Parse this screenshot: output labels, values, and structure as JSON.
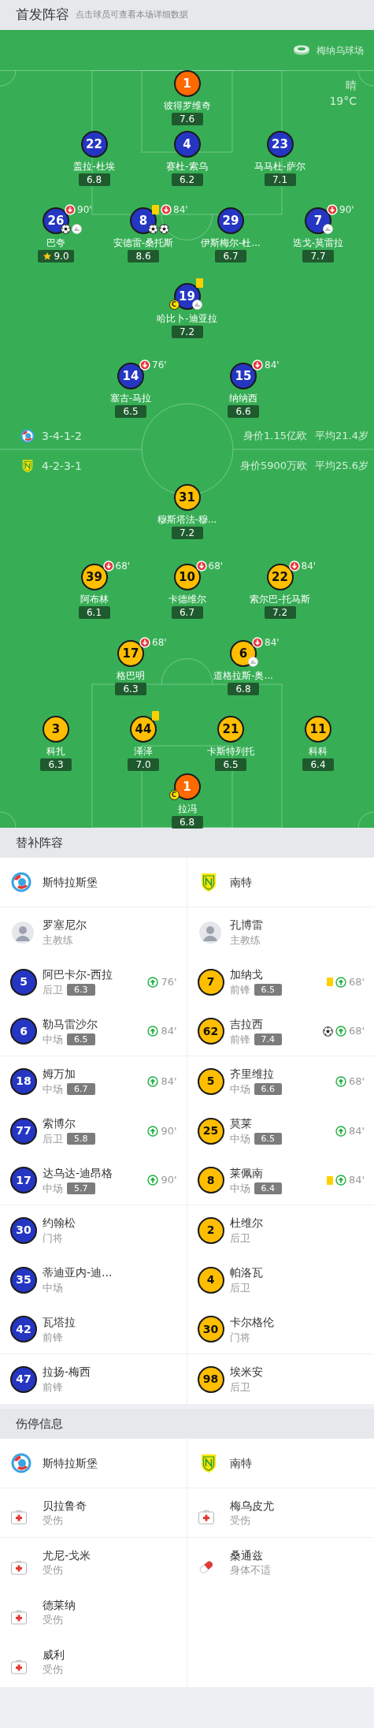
{
  "lineup_header": {
    "title": "首发阵容",
    "hint": "点击球员可查看本场详细数据"
  },
  "pitch": {
    "stadium": "梅纳乌球场",
    "weather": "晴",
    "temperature": "19°C",
    "home": {
      "color": "#2536c3",
      "rows": [
        {
          "kind": "goalkeeper",
          "players": [
            {
              "number": "1",
              "name": "彼得罗维奇",
              "rating": "7.6"
            }
          ]
        },
        {
          "kind": "outfield",
          "players": [
            {
              "number": "22",
              "name": "盖拉-杜埃",
              "rating": "6.8"
            },
            {
              "number": "4",
              "name": "赛杜-索乌",
              "rating": "6.2"
            },
            {
              "number": "23",
              "name": "马马杜-萨尔",
              "rating": "7.1"
            }
          ]
        },
        {
          "kind": "outfield",
          "players": [
            {
              "number": "26",
              "name": "巴夸",
              "rating": "9.0",
              "sub_off": "90'",
              "marks": [
                {
                  "kind": "best"
                }
              ],
              "events": [
                {
                  "kind": "goal"
                },
                {
                  "kind": "assist"
                }
              ]
            },
            {
              "number": "8",
              "name": "安德雷-桑托斯",
              "rating": "8.6",
              "sub_off": "84'",
              "marks": [
                {
                  "kind": "yellow_card"
                }
              ],
              "events": [
                {
                  "kind": "goal"
                },
                {
                  "kind": "goal"
                }
              ]
            },
            {
              "number": "29",
              "name": "伊斯梅尔-杜...",
              "rating": "6.7"
            },
            {
              "number": "7",
              "name": "迭戈-莫雷拉",
              "rating": "7.7",
              "sub_off": "90'",
              "events": [
                {
                  "kind": "assist"
                }
              ]
            }
          ]
        },
        {
          "kind": "outfield",
          "players": [
            {
              "number": "19",
              "name": "哈比卜-迪亚拉",
              "rating": "7.2",
              "marks": [
                {
                  "kind": "yellow_card"
                },
                {
                  "kind": "captain",
                  "label": "C"
                }
              ],
              "events": [
                {
                  "kind": "assist"
                }
              ]
            }
          ]
        },
        {
          "kind": "outfield",
          "players": [
            {
              "number": "14",
              "name": "塞古-马拉",
              "rating": "6.5",
              "sub_off": "76'"
            },
            {
              "number": "15",
              "name": "纳纳西",
              "rating": "6.6",
              "sub_off": "84'"
            }
          ]
        }
      ]
    },
    "summaries": [
      {
        "kind": "strasbourg",
        "formation": "3-4-1-2",
        "value": "身价1.15亿欧",
        "age": "平均21.4岁"
      },
      {
        "kind": "nantes",
        "formation": "4-2-3-1",
        "value": "身价5900万欧",
        "age": "平均25.6岁"
      }
    ],
    "away": {
      "color": "#ffbe00",
      "rows": [
        {
          "kind": "outfield",
          "players": [
            {
              "number": "31",
              "name": "穆斯塔法-穆...",
              "rating": "7.2"
            }
          ]
        },
        {
          "kind": "outfield",
          "players": [
            {
              "number": "39",
              "name": "阿布林",
              "rating": "6.1",
              "sub_off": "68'"
            },
            {
              "number": "10",
              "name": "卡德维尔",
              "rating": "6.7",
              "sub_off": "68'"
            },
            {
              "number": "22",
              "name": "索尔巴-托马斯",
              "rating": "7.2",
              "sub_off": "84'"
            }
          ]
        },
        {
          "kind": "outfield",
          "players": [
            {
              "number": "17",
              "name": "格巴明",
              "rating": "6.3",
              "sub_off": "68'"
            },
            {
              "number": "6",
              "name": "道格拉斯-奥...",
              "rating": "6.8",
              "sub_off": "84'",
              "events": [
                {
                  "kind": "assist"
                }
              ]
            }
          ]
        },
        {
          "kind": "outfield",
          "players": [
            {
              "number": "3",
              "name": "科扎",
              "rating": "6.3"
            },
            {
              "number": "44",
              "name": "泽泽",
              "rating": "7.0",
              "marks": [
                {
                  "kind": "yellow_card"
                }
              ]
            },
            {
              "number": "21",
              "name": "卡斯特列托",
              "rating": "6.5"
            },
            {
              "number": "11",
              "name": "科科",
              "rating": "6.4"
            }
          ]
        },
        {
          "kind": "goalkeeper",
          "players": [
            {
              "number": "1",
              "name": "拉冯",
              "rating": "6.8",
              "marks": [
                {
                  "kind": "captain",
                  "label": "C"
                }
              ]
            }
          ]
        }
      ]
    }
  },
  "substitutes": {
    "title": "替补阵容",
    "teams": [
      {
        "kind": "strasbourg",
        "name": "斯特拉斯堡",
        "color": "#2536c3",
        "coach": {
          "name": "罗塞尼尔",
          "role": "主教练"
        },
        "players": [
          {
            "number": "5",
            "name": "阿巴卡尔-西拉",
            "position": "后卫",
            "rating": "6.3",
            "sub_on": "76'"
          },
          {
            "number": "6",
            "name": "勒马雷沙尔",
            "position": "中场",
            "rating": "6.5",
            "sub_on": "84'"
          },
          {
            "number": "18",
            "name": "姆万加",
            "position": "中场",
            "rating": "6.7",
            "sub_on": "84'"
          },
          {
            "number": "77",
            "name": "索博尔",
            "position": "后卫",
            "rating": "5.8",
            "sub_on": "90'"
          },
          {
            "number": "17",
            "name": "达乌达-迪昂格",
            "position": "中场",
            "rating": "5.7",
            "sub_on": "90'"
          },
          {
            "number": "30",
            "name": "约翰松",
            "position": "门将"
          },
          {
            "number": "35",
            "name": "蒂迪亚内-迪...",
            "position": "中场"
          },
          {
            "number": "42",
            "name": "瓦塔拉",
            "position": "前锋"
          },
          {
            "number": "47",
            "name": "拉扬-梅西",
            "position": "前锋"
          }
        ]
      },
      {
        "kind": "nantes",
        "name": "南特",
        "color": "#ffbe00",
        "coach": {
          "name": "孔博雷",
          "role": "主教练"
        },
        "players": [
          {
            "number": "7",
            "name": "加纳戈",
            "position": "前锋",
            "rating": "6.5",
            "sub_on": "68'",
            "marks": [
              {
                "kind": "yellow_card"
              }
            ]
          },
          {
            "number": "62",
            "name": "吉拉西",
            "position": "前锋",
            "rating": "7.4",
            "sub_on": "68'",
            "marks": [
              {
                "kind": "goal"
              }
            ]
          },
          {
            "number": "5",
            "name": "齐里维拉",
            "position": "中场",
            "rating": "6.6",
            "sub_on": "68'"
          },
          {
            "number": "25",
            "name": "莫莱",
            "position": "中场",
            "rating": "6.5",
            "sub_on": "84'"
          },
          {
            "number": "8",
            "name": "莱佩南",
            "position": "中场",
            "rating": "6.4",
            "sub_on": "84'",
            "marks": [
              {
                "kind": "yellow_card"
              }
            ]
          },
          {
            "number": "2",
            "name": "杜维尔",
            "position": "后卫"
          },
          {
            "number": "4",
            "name": "帕洛瓦",
            "position": "后卫"
          },
          {
            "number": "30",
            "name": "卡尔格伦",
            "position": "门将"
          },
          {
            "number": "98",
            "name": "埃米安",
            "position": "后卫"
          }
        ]
      }
    ]
  },
  "injuries": {
    "title": "伤停信息",
    "teams": [
      {
        "kind": "strasbourg",
        "name": "斯特拉斯堡",
        "players": [
          {
            "kind": "injury",
            "name": "贝拉鲁奇",
            "status": "受伤"
          },
          {
            "kind": "injury",
            "name": "尤尼-戈米",
            "status": "受伤"
          },
          {
            "kind": "injury",
            "name": "德莱纳",
            "status": "受伤"
          },
          {
            "kind": "injury",
            "name": "威利",
            "status": "受伤"
          }
        ]
      },
      {
        "kind": "nantes",
        "name": "南特",
        "players": [
          {
            "kind": "injury",
            "name": "梅乌皮尤",
            "status": "受伤"
          },
          {
            "kind": "illness",
            "name": "桑通兹",
            "status": "身体不适"
          }
        ]
      }
    ]
  }
}
